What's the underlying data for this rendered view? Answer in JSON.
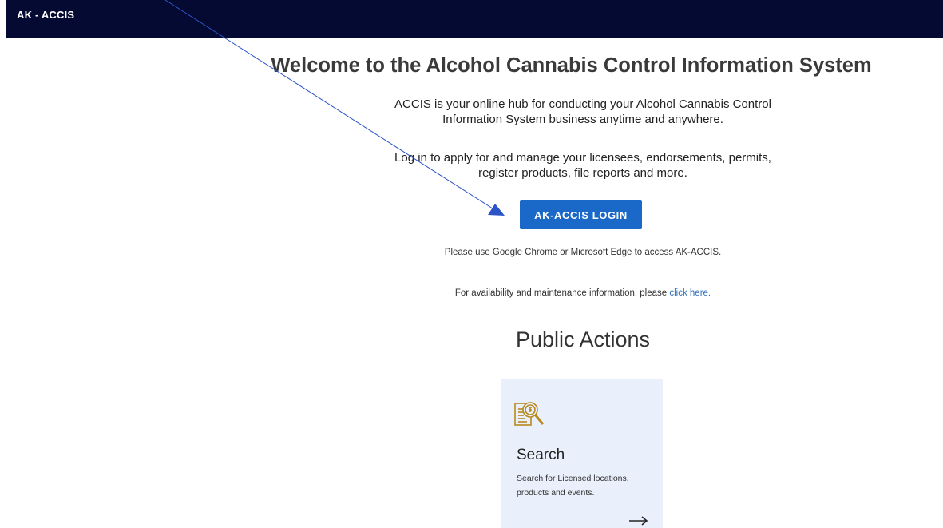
{
  "header": {
    "brand": "AK - ACCIS"
  },
  "main": {
    "welcome_title": "Welcome to the Alcohol Cannabis Control Information System",
    "intro_line1": "ACCIS is your online hub for conducting your Alcohol Cannabis Control",
    "intro_line2": "Information System business anytime and anywhere.",
    "login_line1": "Log in to apply for and manage your licensees, endorsements, permits,",
    "login_line2": "register products, file reports and more.",
    "login_button": "AK-ACCIS LOGIN",
    "browser_note": "Please use Google Chrome or Microsoft Edge to access AK-ACCIS.",
    "availability_text": "For availability and maintenance information, please",
    "availability_link": "click here."
  },
  "public_actions": {
    "title": "Public Actions",
    "cards": [
      {
        "icon": "search-document-icon",
        "title": "Search",
        "description": "Search for Licensed locations, products and events."
      }
    ]
  },
  "colors": {
    "header_bg": "#050a33",
    "button_bg": "#1a69c9",
    "link": "#2f6fb8",
    "card_bg": "#e9f0fb",
    "icon_gold": "#b98a1e",
    "annotation_arrow": "#2c54c8"
  }
}
